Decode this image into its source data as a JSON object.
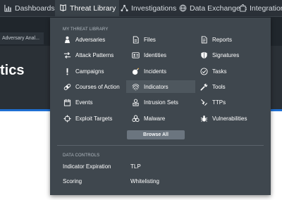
{
  "nav": {
    "items": [
      {
        "label": "Dashboards",
        "icon": "bar-chart-icon"
      },
      {
        "label": "Threat Library",
        "icon": "threat-library-icon"
      },
      {
        "label": "Investigations",
        "icon": "network-icon"
      },
      {
        "label": "Data Exchange",
        "icon": "globe-icon"
      },
      {
        "label": "Integrations",
        "icon": "puzzle-icon"
      }
    ]
  },
  "background": {
    "subtab_label": "Adversary Anal...",
    "hero_title": "tics"
  },
  "menu": {
    "section_title": "MY THREAT LIBRARY",
    "items": [
      {
        "label": "Adversaries",
        "icon": "adversary-icon"
      },
      {
        "label": "Attack Patterns",
        "icon": "attack-pattern-icon"
      },
      {
        "label": "Campaigns",
        "icon": "campaign-icon"
      },
      {
        "label": "Courses of Action",
        "icon": "bandage-icon"
      },
      {
        "label": "Events",
        "icon": "calendar-icon"
      },
      {
        "label": "Exploit Targets",
        "icon": "crosshair-icon"
      },
      {
        "label": "Files",
        "icon": "file-icon"
      },
      {
        "label": "Identities",
        "icon": "id-card-icon"
      },
      {
        "label": "Incidents",
        "icon": "bomb-icon"
      },
      {
        "label": "Indicators",
        "icon": "fingerprint-icon"
      },
      {
        "label": "Intrusion Sets",
        "icon": "intrusion-set-icon"
      },
      {
        "label": "Malware",
        "icon": "biohazard-icon"
      },
      {
        "label": "Reports",
        "icon": "report-icon"
      },
      {
        "label": "Signatures",
        "icon": "shield-icon"
      },
      {
        "label": "Tasks",
        "icon": "check-circle-icon"
      },
      {
        "label": "Tools",
        "icon": "wrench-icon"
      },
      {
        "label": "TTPs",
        "icon": "ttp-icon"
      },
      {
        "label": "Vulnerabilities",
        "icon": "bug-icon"
      }
    ],
    "selected": "Indicators",
    "browse_label": "Browse All"
  },
  "data_controls": {
    "section_title": "DATA CONTROLS",
    "items": [
      "Indicator Expiration",
      "TLP",
      "Scoring",
      "Whitelisting"
    ]
  },
  "colors": {
    "nav_bg": "#2b3138",
    "menu_bg": "#3f474e",
    "accent_blue": "#1f6fd1",
    "selected_bg": "#4e575e"
  }
}
